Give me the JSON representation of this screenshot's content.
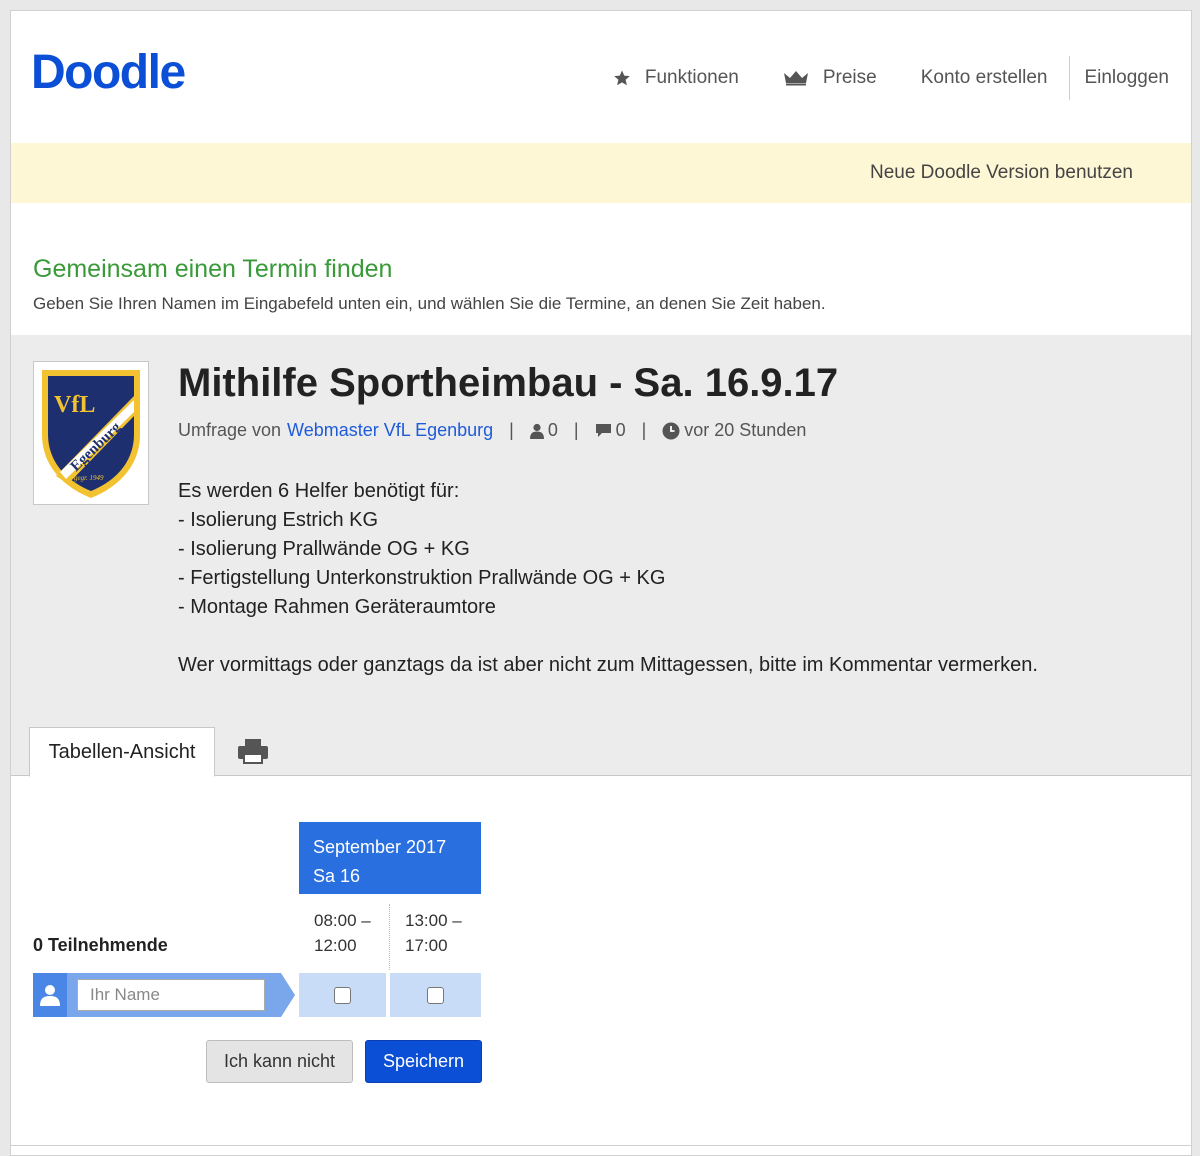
{
  "header": {
    "logo": "Doodle",
    "nav": [
      {
        "label": "Funktionen",
        "icon": "star-icon"
      },
      {
        "label": "Preise",
        "icon": "crown-icon"
      },
      {
        "label": "Konto erstellen"
      },
      {
        "label": "Einloggen"
      }
    ]
  },
  "banner": {
    "link": "Neue Doodle Version benutzen"
  },
  "intro": {
    "title": "Gemeinsam einen Termin finden",
    "subtitle": "Geben Sie Ihren Namen im Eingabefeld unten ein, und wählen Sie die Termine, an denen Sie Zeit haben."
  },
  "poll": {
    "title": "Mithilfe Sportheimbau - Sa. 16.9.17",
    "by_prefix": "Umfrage von",
    "author": "Webmaster VfL Egenburg",
    "participants_count": "0",
    "comments_count": "0",
    "created": "vor 20 Stunden",
    "crest_text": {
      "top": "VfL",
      "band": "Egenburg",
      "founded": "gegr. 1949"
    },
    "description": [
      "Es werden 6 Helfer benötigt für:",
      "- Isolierung Estrich KG",
      "- Isolierung Prallwände OG + KG",
      "- Fertigstellung Unterkonstruktion Prallwände OG + KG",
      "- Montage Rahmen Geräteraumtore",
      "",
      "Wer vormittags oder ganztags da ist aber nicht zum Mittagessen, bitte im Kommentar vermerken."
    ]
  },
  "tabs": {
    "active": "Tabellen-Ansicht",
    "print_icon": "printer-icon"
  },
  "table": {
    "month": "September 2017",
    "day": "Sa 16",
    "slots": [
      {
        "from": "08:00 –",
        "to": "12:00"
      },
      {
        "from": "13:00 –",
        "to": "17:00"
      }
    ],
    "participants_label": "0 Teilnehmende",
    "name_placeholder": "Ihr Name"
  },
  "buttons": {
    "cant": "Ich kann nicht",
    "save": "Speichern"
  },
  "colors": {
    "brand": "#0b4fd6",
    "green": "#3a9a3a",
    "banner": "#fdf7d6",
    "date_head": "#2a6fe0"
  }
}
